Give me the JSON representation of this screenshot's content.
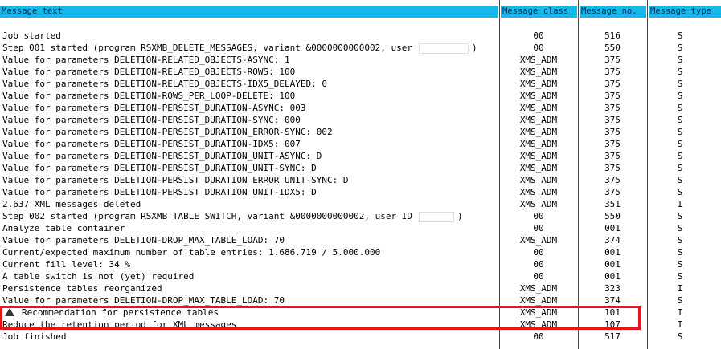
{
  "columns": {
    "text": "Message text",
    "cls": "Message class",
    "no": "Message no.",
    "type": "Message type"
  },
  "rows": [
    {
      "text": "",
      "cls": "",
      "no": "",
      "type": ""
    },
    {
      "text": "Job started",
      "cls": "00",
      "no": "516",
      "type": "S"
    },
    {
      "text": "Step 001 started (program RSXMB_DELETE_MESSAGES, variant &0000000000002, user",
      "suffix": ")",
      "cls": "00",
      "no": "550",
      "type": "S"
    },
    {
      "text": "Value for parameters DELETION-RELATED_OBJECTS-ASYNC: 1",
      "cls": "XMS_ADM",
      "no": "375",
      "type": "S"
    },
    {
      "text": "Value for parameters DELETION-RELATED_OBJECTS-ROWS: 100",
      "cls": "XMS_ADM",
      "no": "375",
      "type": "S"
    },
    {
      "text": "Value for parameters DELETION-RELATED_OBJECTS-IDX5_DELAYED: 0",
      "cls": "XMS_ADM",
      "no": "375",
      "type": "S"
    },
    {
      "text": "Value for parameters DELETION-ROWS_PER_LOOP-DELETE: 100",
      "cls": "XMS_ADM",
      "no": "375",
      "type": "S"
    },
    {
      "text": "Value for parameters DELETION-PERSIST_DURATION-ASYNC: 003",
      "cls": "XMS_ADM",
      "no": "375",
      "type": "S"
    },
    {
      "text": "Value for parameters DELETION-PERSIST_DURATION-SYNC: 000",
      "cls": "XMS_ADM",
      "no": "375",
      "type": "S"
    },
    {
      "text": "Value for parameters DELETION-PERSIST_DURATION_ERROR-SYNC: 002",
      "cls": "XMS_ADM",
      "no": "375",
      "type": "S"
    },
    {
      "text": "Value for parameters DELETION-PERSIST_DURATION-IDX5: 007",
      "cls": "XMS_ADM",
      "no": "375",
      "type": "S"
    },
    {
      "text": "Value for parameters DELETION-PERSIST_DURATION_UNIT-ASYNC: D",
      "cls": "XMS_ADM",
      "no": "375",
      "type": "S"
    },
    {
      "text": "Value for parameters DELETION-PERSIST_DURATION_UNIT-SYNC: D",
      "cls": "XMS_ADM",
      "no": "375",
      "type": "S"
    },
    {
      "text": "Value for parameters DELETION-PERSIST_DURATION_ERROR_UNIT-SYNC: D",
      "cls": "XMS_ADM",
      "no": "375",
      "type": "S"
    },
    {
      "text": "Value for parameters DELETION-PERSIST_DURATION_UNIT-IDX5: D",
      "cls": "XMS_ADM",
      "no": "375",
      "type": "S"
    },
    {
      "text": "2.637 XML messages deleted",
      "cls": "XMS_ADM",
      "no": "351",
      "type": "I"
    },
    {
      "text": "Step 002 started (program RSXMB_TABLE_SWITCH, variant &0000000000002, user ID",
      "suffix": ")",
      "cls": "00",
      "no": "550",
      "type": "S"
    },
    {
      "text": "Analyze table container",
      "cls": "00",
      "no": "001",
      "type": "S"
    },
    {
      "text": "Value for parameters DELETION-DROP_MAX_TABLE_LOAD: 70",
      "cls": "XMS_ADM",
      "no": "374",
      "type": "S"
    },
    {
      "text": "Current/expected maximum number of table entries: 1.686.719 / 5.000.000",
      "cls": "00",
      "no": "001",
      "type": "S"
    },
    {
      "text": "Current fill level: 34 %",
      "cls": "00",
      "no": "001",
      "type": "S"
    },
    {
      "text": "A table switch is not (yet) required",
      "cls": "00",
      "no": "001",
      "type": "S"
    },
    {
      "text": "Persistence tables reorganized",
      "cls": "XMS_ADM",
      "no": "323",
      "type": "I"
    },
    {
      "text": "Value for parameters DELETION-DROP_MAX_TABLE_LOAD: 70",
      "cls": "XMS_ADM",
      "no": "374",
      "type": "S"
    },
    {
      "text": "Recommendation for persistence tables",
      "cls": "XMS_ADM",
      "no": "101",
      "type": "I",
      "icon": "warning-triangle-icon"
    },
    {
      "text": "Reduce the retention period for XML messages",
      "cls": "XMS_ADM",
      "no": "107",
      "type": "I"
    },
    {
      "text": "Job finished",
      "cls": "00",
      "no": "517",
      "type": "S"
    }
  ],
  "colors": {
    "header_bg": "#16b8ec",
    "highlight_border": "#e8141c"
  }
}
